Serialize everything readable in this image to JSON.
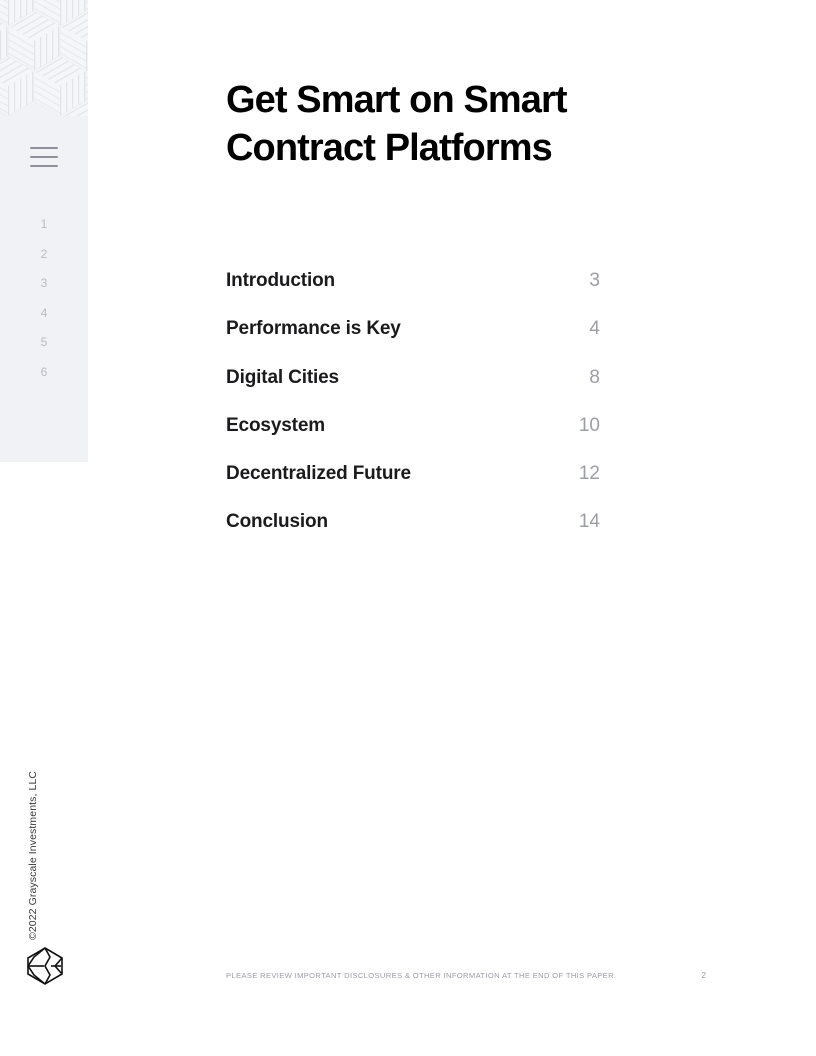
{
  "document": {
    "title": "Get Smart on Smart Contract Platforms"
  },
  "sidebar": {
    "menu_icon": "hamburger-menu-icon",
    "page_index": [
      "1",
      "2",
      "3",
      "4",
      "5",
      "6"
    ],
    "copyright": "©2022 Grayscale Investments, LLC",
    "logo_name": "grayscale-logo",
    "background_color": "#f1f2f6",
    "pattern_color": "#e5e7ec"
  },
  "toc": {
    "entries": [
      {
        "label": "Introduction",
        "page": "3"
      },
      {
        "label": "Performance is Key",
        "page": "4"
      },
      {
        "label": "Digital Cities",
        "page": "8"
      },
      {
        "label": "Ecosystem",
        "page": "10"
      },
      {
        "label": "Decentralized Future",
        "page": "12"
      },
      {
        "label": "Conclusion",
        "page": "14"
      }
    ]
  },
  "footer": {
    "note": "PLEASE REVIEW IMPORTANT DISCLOSURES & OTHER INFORMATION AT THE END OF THIS PAPER.",
    "page_number": "2"
  }
}
